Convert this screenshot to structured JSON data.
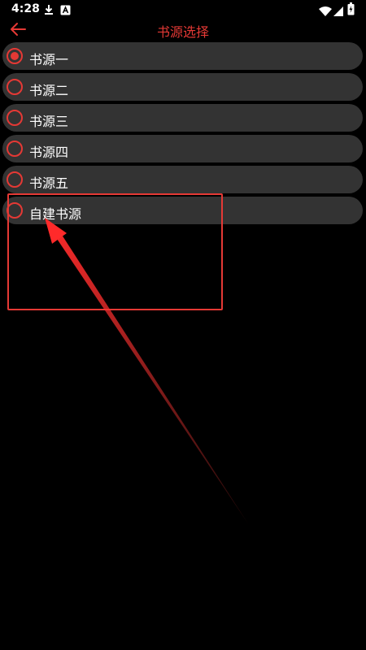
{
  "status_bar": {
    "time": "4:28",
    "icons": [
      "download-icon",
      "app-a-icon",
      "wifi-icon",
      "signal-icon",
      "battery-icon"
    ]
  },
  "app_bar": {
    "title": "书源选择",
    "back_icon": "arrow-left-icon"
  },
  "sources": [
    {
      "label": "书源一",
      "selected": true
    },
    {
      "label": "书源二",
      "selected": false
    },
    {
      "label": "书源三",
      "selected": false
    },
    {
      "label": "书源四",
      "selected": false
    },
    {
      "label": "书源五",
      "selected": false
    },
    {
      "label": "自建书源",
      "selected": false
    }
  ],
  "colors": {
    "accent": "#e53935",
    "item_background": "#333333",
    "page_background": "#000000"
  }
}
